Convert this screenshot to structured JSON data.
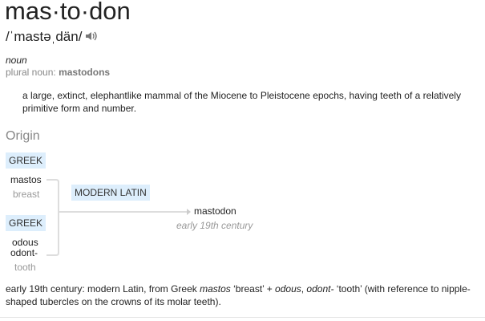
{
  "headword": "mas·to·don",
  "pronunciation": "/ˈmastəˌdän/",
  "part_of_speech": "noun",
  "plural_label": "plural noun:",
  "plural_value": "mastodons",
  "definition": "a large, extinct, elephantlike mammal of the Miocene to Pleistocene epochs, having teeth of a relatively primitive form and number.",
  "origin": {
    "title": "Origin",
    "source1": {
      "lang": "GREEK",
      "word": "mastos",
      "gloss": "breast"
    },
    "source2": {
      "lang": "GREEK",
      "word": "odous",
      "word2": "odont-",
      "gloss": "tooth"
    },
    "intermediate": "MODERN LATIN",
    "result": {
      "word": "mastodon",
      "date": "early 19th century"
    }
  },
  "etymology": {
    "p1": "early 19th century: modern Latin, from Greek ",
    "i1": "mastos",
    "p2": " ‘breast’ + ",
    "i2": "odous",
    "p3": ", ",
    "i3": "odont-",
    "p4": " ‘tooth’ (with reference to nipple-shaped tubercles on the crowns of its molar teeth)."
  }
}
